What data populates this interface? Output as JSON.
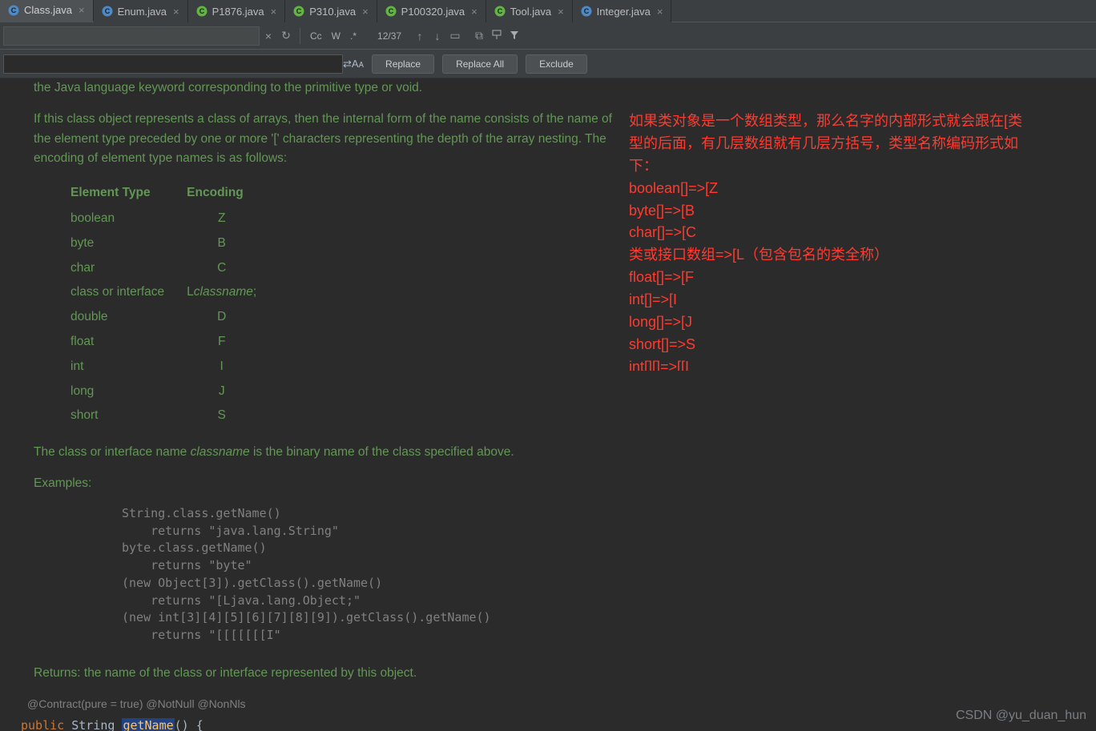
{
  "tabs": [
    {
      "label": "Class.java",
      "active": true,
      "iconColor": "#4e8ac6",
      "letter": "C"
    },
    {
      "label": "Enum.java",
      "active": false,
      "iconColor": "#4e8ac6",
      "letter": "C"
    },
    {
      "label": "P1876.java",
      "active": false,
      "iconColor": "#62b543",
      "letter": "C"
    },
    {
      "label": "P310.java",
      "active": false,
      "iconColor": "#62b543",
      "letter": "C"
    },
    {
      "label": "P100320.java",
      "active": false,
      "iconColor": "#62b543",
      "letter": "C"
    },
    {
      "label": "Tool.java",
      "active": false,
      "iconColor": "#62b543",
      "letter": "C"
    },
    {
      "label": "Integer.java",
      "active": false,
      "iconColor": "#4e8ac6",
      "letter": "C"
    }
  ],
  "find": {
    "count": "12/37",
    "cc": "Cc",
    "w": "W",
    "regex": ".*",
    "close": "×",
    "history": "↻",
    "up": "↑",
    "down": "↓",
    "selection": "▭",
    "multi": "⧉",
    "pin": "📌",
    "filter": "▼"
  },
  "replace": {
    "swap": "⇄",
    "keep": "Aᴀ",
    "btn_replace": "Replace",
    "btn_replace_all": "Replace All",
    "btn_exclude": "Exclude"
  },
  "doc": {
    "p1": "the Java language keyword corresponding to the primitive type or void.",
    "p2": "If this class object represents a class of arrays, then the internal form of the name consists of the name of the element type preceded by one or more '[' characters representing the depth of the array nesting. The encoding of element type names is as follows:",
    "th1": "Element Type",
    "th2": "Encoding",
    "rows": [
      {
        "t": "boolean",
        "e": "Z"
      },
      {
        "t": "byte",
        "e": "B"
      },
      {
        "t": "char",
        "e": "C"
      },
      {
        "t": "class or interface",
        "e": "Lclassname;",
        "ital": true
      },
      {
        "t": "double",
        "e": "D"
      },
      {
        "t": "float",
        "e": "F"
      },
      {
        "t": "int",
        "e": "I"
      },
      {
        "t": "long",
        "e": "J"
      },
      {
        "t": "short",
        "e": "S"
      }
    ],
    "p3a": "The class or interface name ",
    "p3i": "classname",
    "p3b": " is the binary name of the class specified above.",
    "p4": "Examples:",
    "code": "String.class.getName()\n    returns \"java.lang.String\"\nbyte.class.getName()\n    returns \"byte\"\n(new Object[3]).getClass().getName()\n    returns \"[Ljava.lang.Object;\"\n(new int[3][4][5][6][7][8][9]).getClass().getName()\n    returns \"[[[[[[[I\"",
    "p5": "Returns: the name of the class or interface represented by this object.",
    "annots": "@Contract(pure = true)    @NotNull    @NonNls",
    "code_kw": "public",
    "code_typ": " String ",
    "code_mth": "getName",
    "code_tail": "() {"
  },
  "red": {
    "l1": "如果类对象是一个数组类型，那么名字的内部形式就会跟在[类",
    "l2": "型的后面，有几层数组就有几层方括号，类型名称编码形式如",
    "l3": "下：",
    "l4": "boolean[]=>[Z",
    "l5": "byte[]=>[B",
    "l6": "char[]=>[C",
    "l7": "类或接口数组=>[L（包含包名的类全称）",
    "l8": "float[]=>[F",
    "l9": "int[]=>[I",
    "l10": "long[]=>[J",
    "l11": "short[]=>S",
    "l12": "int[][]=>[[I"
  },
  "watermark": "CSDN @yu_duan_hun"
}
